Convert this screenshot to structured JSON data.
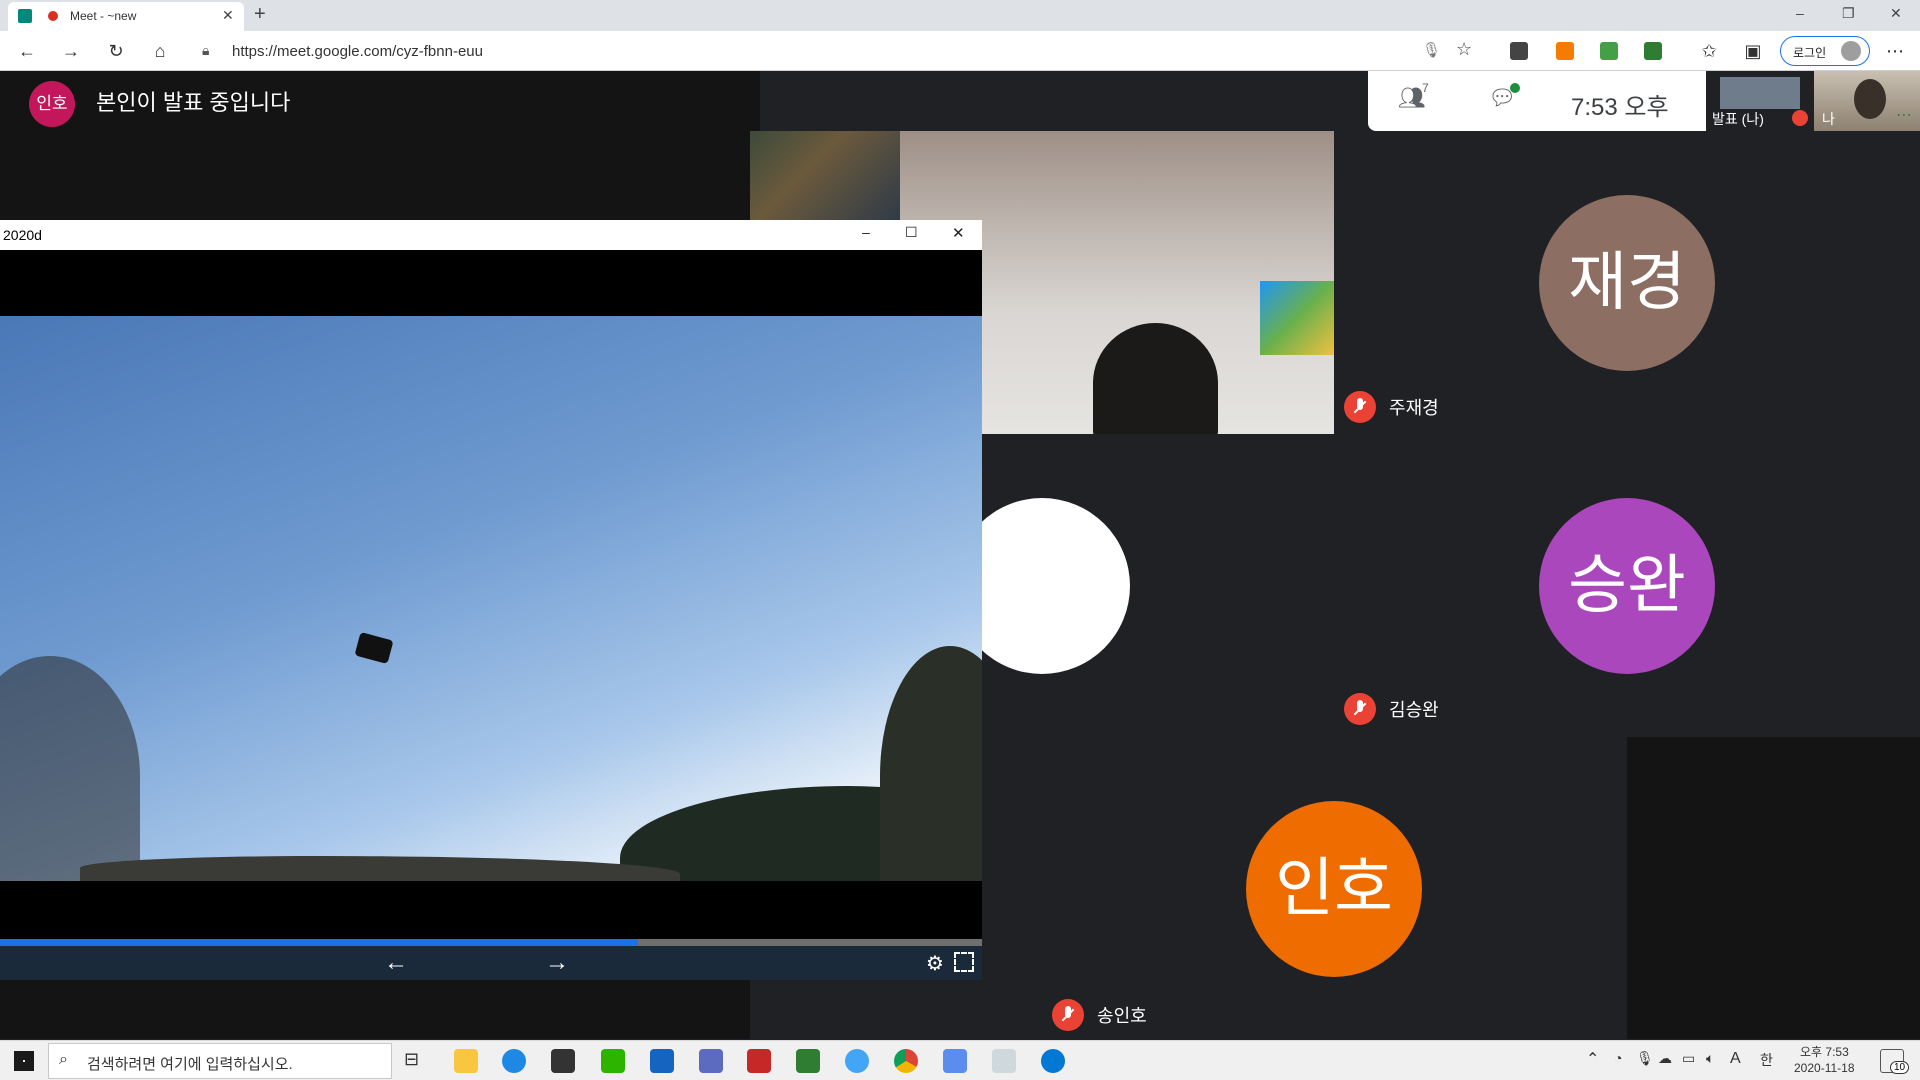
{
  "browser": {
    "tab_title": "Meet - ~new",
    "url": "https://meet.google.com/cyz-fbnn-euu",
    "new_tab": "+",
    "login_label": "로그인",
    "window_buttons": [
      "–",
      "❐",
      "✕"
    ]
  },
  "meet": {
    "presenter_initials": "인호",
    "presenting_text": "본인이 발표 중입니다",
    "participant_count": "7",
    "time": "7:53 오후",
    "self_tile_label": "발표 (나)",
    "self_label": "나",
    "more": "⋯",
    "participants": [
      {
        "name": "주재경",
        "initials": "재경",
        "color": "#8d6e63"
      },
      {
        "name": "김승완",
        "initials": "승완",
        "color": "#ab47bc"
      },
      {
        "name": "송인호",
        "initials": "인호",
        "color": "#ef6c00"
      }
    ]
  },
  "viewer": {
    "title": "2020d",
    "progress": 0.65,
    "prev": "←",
    "next": "→"
  },
  "taskbar": {
    "search_placeholder": "검색하려면 여기에 입력하십시오.",
    "ime": "A",
    "lang": "한",
    "clock_time": "오후 7:53",
    "clock_date": "2020-11-18",
    "notification_count": "10"
  }
}
